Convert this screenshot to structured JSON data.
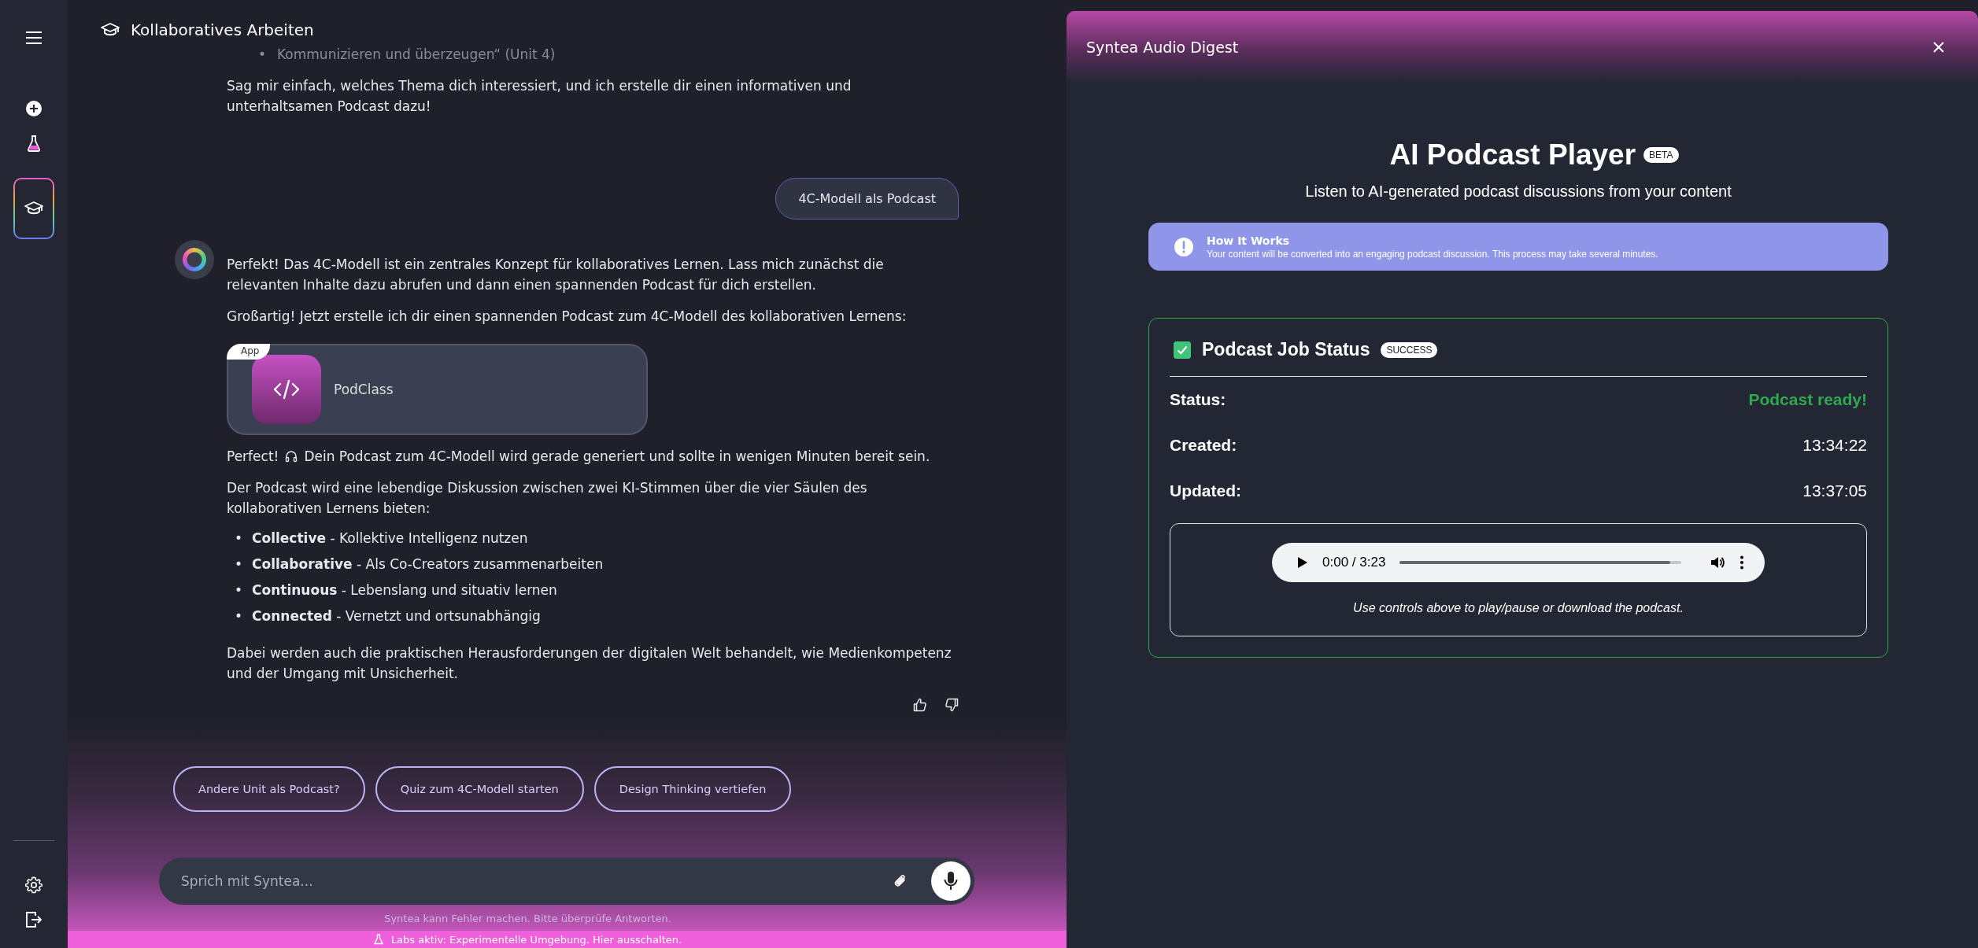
{
  "sidebar": {
    "nav": [
      {
        "selected": false
      },
      {
        "selected": false
      },
      {
        "selected": true
      }
    ]
  },
  "header": {
    "title": "Kollaboratives Arbeiten"
  },
  "messages": [
    {
      "kind": "assistant_message",
      "avatar": false,
      "feedback": false,
      "blocks": [
        {
          "kind": "faded_bullet",
          "marker": "•",
          "text": "Kommunizieren und überzeugen“ (Unit 4)"
        },
        {
          "kind": "paragraph",
          "text": "Sag mir einfach, welches Thema dich interessiert, und ich erstelle dir einen informativen und unterhaltsamen Podcast dazu!"
        }
      ]
    },
    {
      "kind": "user_message",
      "text": "4C-Modell als Podcast"
    },
    {
      "kind": "assistant_message",
      "avatar": true,
      "feedback": true,
      "blocks": [
        {
          "kind": "paragraph",
          "text": "Perfekt! Das 4C-Modell ist ein zentrales Konzept für kollaboratives Lernen. Lass mich zunächst die relevanten Inhalte dazu abrufen und dann einen spannenden Podcast für dich erstellen."
        },
        {
          "kind": "paragraph",
          "text": "Großartig! Jetzt erstelle ich dir einen spannenden Podcast zum 4C-Modell des kollaborativen Lernens:"
        },
        {
          "kind": "app_card",
          "tag": "App",
          "name": "PodClass"
        },
        {
          "kind": "icon_paragraph",
          "before": "Perfect!",
          "after": "Dein Podcast zum 4C-Modell wird gerade generiert und sollte in wenigen Minuten bereit sein."
        },
        {
          "kind": "paragraph",
          "text": "Der Podcast wird eine lebendige Diskussion zwischen zwei KI-Stimmen über die vier Säulen des kollaborativen Lernens bieten:"
        },
        {
          "kind": "list",
          "marker": "•",
          "items": [
            "**Collective** - Kollektive Intelligenz nutzen",
            "**Collaborative** - Als Co-Creators zusammenarbeiten",
            "**Continuous** - Lebenslang und situativ lernen",
            "**Connected** - Vernetzt und ortsunabhängig"
          ]
        },
        {
          "kind": "paragraph",
          "text": "Dabei werden auch die praktischen Herausforderungen der digitalen Welt behandelt, wie Medienkompetenz und der Umgang mit Unsicherheit."
        }
      ]
    }
  ],
  "suggestions": [
    "Andere Unit als Podcast?",
    "Quiz zum 4C-Modell starten",
    "Design Thinking vertiefen"
  ],
  "input": {
    "placeholder": "Sprich mit Syntea..."
  },
  "disclaimer": "Syntea kann Fehler machen. Bitte überprüfe Antworten.",
  "labs_banner": "Labs aktiv: Experimentelle Umgebung. Hier ausschalten.",
  "panel": {
    "title": "Syntea Audio Digest",
    "heading": "AI Podcast Player",
    "badge": "BETA",
    "subtitle": "Listen to AI-generated podcast discussions from your content",
    "info": {
      "title": "How It Works",
      "text": "Your content will be converted into an engaging podcast discussion. This process may take several minutes."
    },
    "job": {
      "title": "Podcast Job Status",
      "badge": "SUCCESS",
      "checked": true,
      "fields": [
        {
          "label": "Status:",
          "value": "Podcast ready!",
          "kind": "success"
        },
        {
          "label": "Created:",
          "value": "13:34:22",
          "kind": "plain"
        },
        {
          "label": "Updated:",
          "value": "13:37:05",
          "kind": "plain"
        }
      ],
      "player": {
        "time": "0:00 / 3:23",
        "level": 0.96
      },
      "note": "Use controls above to play/pause or download the podcast."
    }
  }
}
